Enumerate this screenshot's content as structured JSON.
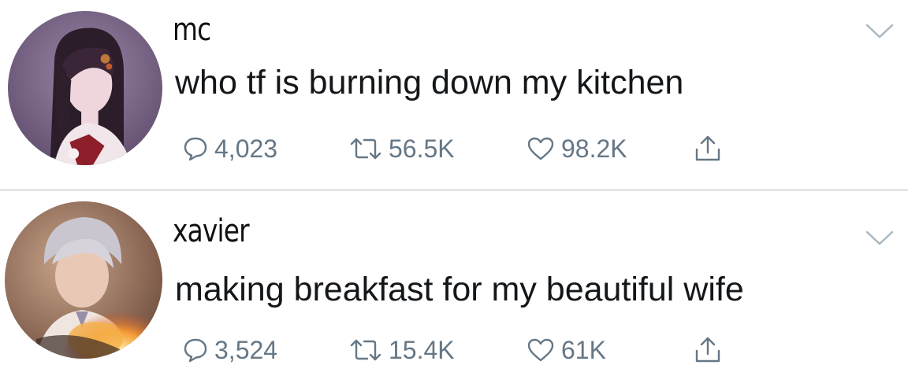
{
  "tweets": [
    {
      "username": "mc",
      "text": "who tf is burning down my kitchen",
      "replies": "4,023",
      "retweets": "56.5K",
      "likes": "98.2K"
    },
    {
      "username": "xavier",
      "text": "making breakfast for my beautiful wife",
      "replies": "3,524",
      "retweets": "15.4K",
      "likes": "61K"
    }
  ],
  "colors": {
    "text": "#14171a",
    "icon": "#657786",
    "divider": "#e6e6e6",
    "chevron": "#aab8c2"
  },
  "icons": {
    "reply": "speech-bubble-icon",
    "retweet": "retweet-arrows-icon",
    "like": "heart-outline-icon",
    "share": "share-upload-icon",
    "menu": "chevron-down-icon"
  }
}
